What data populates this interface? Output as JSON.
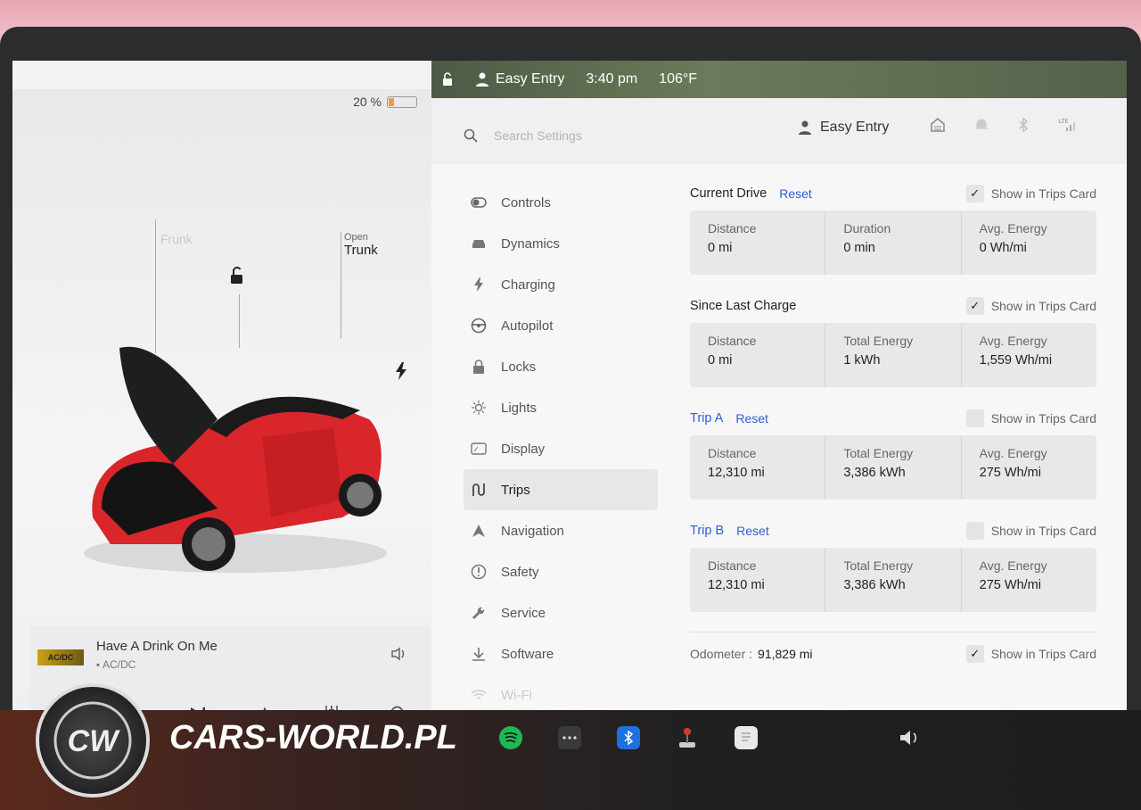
{
  "status_bar": {
    "profile": "Easy Entry",
    "time": "3:40 pm",
    "temperature": "106°F"
  },
  "car_panel": {
    "battery_percent": "20 %",
    "battery_level": 0.2,
    "frunk_label": "Frunk",
    "trunk_small": "Open",
    "trunk_big": "Trunk"
  },
  "music": {
    "album_badge": "AC/DC",
    "song": "Have A Drink On Me",
    "artist": "AC/DC"
  },
  "settings": {
    "search_placeholder": "Search Settings",
    "profile_name": "Easy Entry",
    "nav": [
      {
        "label": "Controls",
        "icon": "toggle-icon"
      },
      {
        "label": "Dynamics",
        "icon": "car-icon"
      },
      {
        "label": "Charging",
        "icon": "bolt-icon"
      },
      {
        "label": "Autopilot",
        "icon": "steering-icon"
      },
      {
        "label": "Locks",
        "icon": "lock-icon"
      },
      {
        "label": "Lights",
        "icon": "sun-icon"
      },
      {
        "label": "Display",
        "icon": "display-icon"
      },
      {
        "label": "Trips",
        "icon": "trips-icon"
      },
      {
        "label": "Navigation",
        "icon": "navigation-icon"
      },
      {
        "label": "Safety",
        "icon": "safety-icon"
      },
      {
        "label": "Service",
        "icon": "wrench-icon"
      },
      {
        "label": "Software",
        "icon": "download-icon"
      },
      {
        "label": "Wi-Fi",
        "icon": "wifi-icon"
      }
    ],
    "show_in_trips_card": "Show in Trips Card",
    "reset": "Reset",
    "sections": [
      {
        "title": "Current Drive",
        "has_reset": true,
        "checked": true,
        "stats": [
          {
            "label": "Distance",
            "value": "0 mi"
          },
          {
            "label": "Duration",
            "value": "0 min"
          },
          {
            "label": "Avg. Energy",
            "value": "0 Wh/mi"
          }
        ]
      },
      {
        "title": "Since Last Charge",
        "has_reset": false,
        "checked": true,
        "stats": [
          {
            "label": "Distance",
            "value": "0 mi"
          },
          {
            "label": "Total Energy",
            "value": "1 kWh"
          },
          {
            "label": "Avg. Energy",
            "value": "1,559 Wh/mi"
          }
        ]
      },
      {
        "title": "Trip A",
        "has_reset": true,
        "checked": false,
        "stats": [
          {
            "label": "Distance",
            "value": "12,310 mi"
          },
          {
            "label": "Total Energy",
            "value": "3,386 kWh"
          },
          {
            "label": "Avg. Energy",
            "value": "275 Wh/mi"
          }
        ]
      },
      {
        "title": "Trip B",
        "has_reset": true,
        "checked": false,
        "stats": [
          {
            "label": "Distance",
            "value": "12,310 mi"
          },
          {
            "label": "Total Energy",
            "value": "3,386 kWh"
          },
          {
            "label": "Avg. Energy",
            "value": "275 Wh/mi"
          }
        ]
      }
    ],
    "odometer_label": "Odometer :",
    "odometer_value": "91,829 mi",
    "odometer_checked": true
  },
  "taskbar": {
    "brand": "CARS-WORLD.PL",
    "icons": [
      "spotify-icon",
      "more-icon",
      "bluetooth-icon",
      "joystick-icon",
      "notepad-icon"
    ],
    "volume_icon": "volume-icon"
  },
  "colors": {
    "accent": "#2d5fd3",
    "car_red": "#d8262a",
    "spotify": "#1db954",
    "bluetooth": "#1e6fe0"
  }
}
